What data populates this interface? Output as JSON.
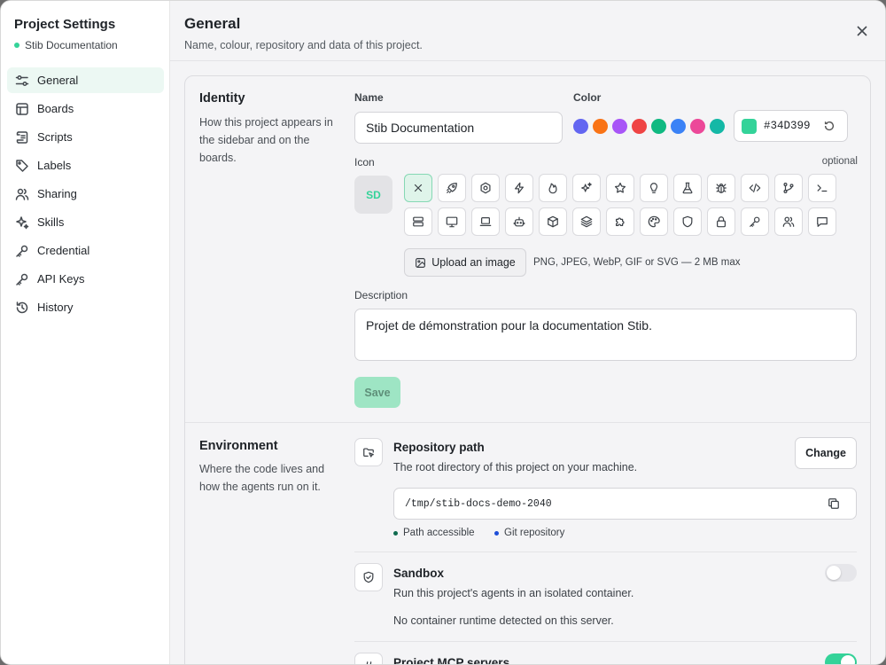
{
  "sidebar": {
    "title": "Project Settings",
    "project_name": "Stib Documentation",
    "project_dot_color": "#34D399",
    "items": [
      {
        "label": "General",
        "icon": "settings-sliders-icon",
        "active": true
      },
      {
        "label": "Boards",
        "icon": "board-icon"
      },
      {
        "label": "Scripts",
        "icon": "script-icon"
      },
      {
        "label": "Labels",
        "icon": "tag-icon"
      },
      {
        "label": "Sharing",
        "icon": "users-icon"
      },
      {
        "label": "Skills",
        "icon": "sparkles-icon"
      },
      {
        "label": "Credential",
        "icon": "key-icon"
      },
      {
        "label": "API Keys",
        "icon": "key-icon"
      },
      {
        "label": "History",
        "icon": "history-icon"
      }
    ]
  },
  "header": {
    "title": "General",
    "subtitle": "Name, colour, repository and data of this project."
  },
  "identity": {
    "title": "Identity",
    "description": "How this project appears in the sidebar and on the boards.",
    "name_label": "Name",
    "name_value": "Stib Documentation",
    "color_label": "Color",
    "swatches": [
      "#6366F1",
      "#F97316",
      "#A855F7",
      "#EF4444",
      "#10B981",
      "#3B82F6",
      "#EC4899",
      "#14B8A6"
    ],
    "selected_color": "#34D399",
    "hex_value": "#34D399",
    "icon_label": "Icon",
    "optional_label": "optional",
    "avatar_initials": "SD",
    "icons": [
      "close-icon",
      "rocket-icon",
      "gear-icon",
      "lightning-icon",
      "flame-icon",
      "sparkles-icon",
      "star-icon",
      "lightbulb-icon",
      "flask-icon",
      "bug-icon",
      "code-icon",
      "git-branch-icon",
      "terminal-icon",
      "server-icon",
      "monitor-icon",
      "laptop-icon",
      "robot-icon",
      "cube-icon",
      "layers-icon",
      "puzzle-icon",
      "palette-icon",
      "shield-icon",
      "lock-icon",
      "key-icon",
      "users-icon",
      "chat-icon"
    ],
    "upload_label": "Upload an image",
    "upload_hint": "PNG, JPEG, WebP, GIF or SVG — 2 MB max",
    "description_label": "Description",
    "description_value": "Projet de démonstration pour la documentation Stib.",
    "save_label": "Save"
  },
  "environment": {
    "title": "Environment",
    "description": "Where the code lives and how the agents run on it.",
    "repo_title": "Repository path",
    "repo_desc": "The root directory of this project on your machine.",
    "change_label": "Change",
    "path_value": "/tmp/stib-docs-demo-2040",
    "status_accessible": "Path accessible",
    "status_git": "Git repository",
    "status_accessible_color": "#0F6B4F",
    "status_git_color": "#1D4ED8",
    "sandbox_title": "Sandbox",
    "sandbox_desc": "Run this project's agents in an isolated container.",
    "sandbox_note": "No container runtime detected on this server.",
    "sandbox_enabled": false,
    "mcp_title": "Project MCP servers",
    "mcp_enabled": true
  }
}
